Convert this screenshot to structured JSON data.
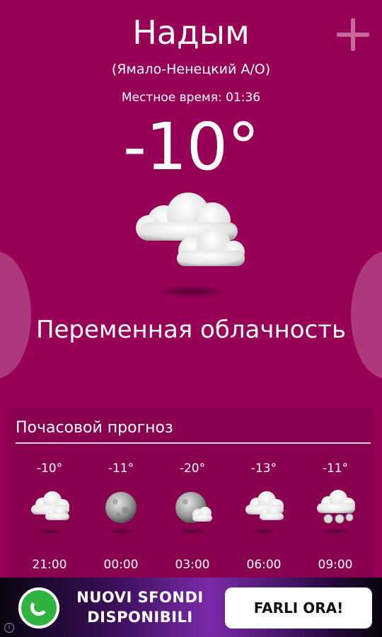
{
  "location": {
    "city": "Надым",
    "region": "(Ямало-Ненецкий А/О)",
    "local_time": "Местное время: 01:36"
  },
  "current": {
    "temperature": "-10°",
    "condition": "Переменная облачность",
    "icon": "partly-cloudy-icon"
  },
  "hourly": {
    "title": "Почасовой прогноз",
    "items": [
      {
        "temp": "-10°",
        "time": "21:00",
        "icon": "cloudy-icon"
      },
      {
        "temp": "-11°",
        "time": "00:00",
        "icon": "moon-icon"
      },
      {
        "temp": "-20°",
        "time": "03:00",
        "icon": "moon-cloud-icon"
      },
      {
        "temp": "-13°",
        "time": "06:00",
        "icon": "cloudy-icon"
      },
      {
        "temp": "-11°",
        "time": "09:00",
        "icon": "snow-cloud-icon"
      }
    ]
  },
  "ad": {
    "headline": "NUOVI SFONDI DISPONIBILI",
    "cta": "FARLI ORA!",
    "info": "i"
  },
  "colors": {
    "background": "#970056",
    "accent_plus": "#c56a9a"
  }
}
